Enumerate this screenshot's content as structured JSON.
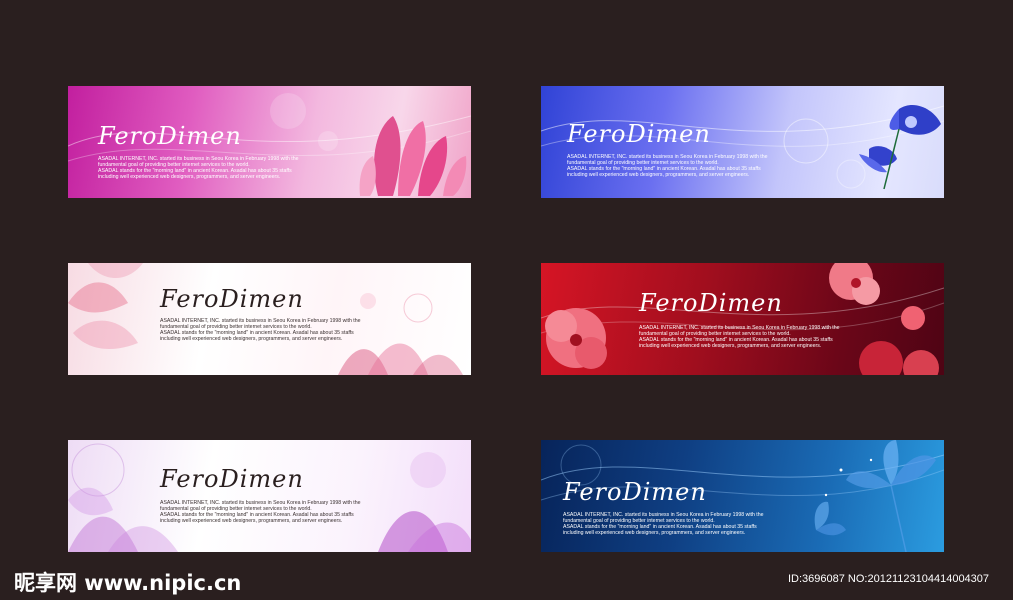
{
  "banners": [
    {
      "title": "FeroDimen",
      "description": [
        "ASADAL INTERNET, INC. started its business in Seou Korea in February 1998 with the",
        "fundamental goal of providing better internet services to the world.",
        "ASADAL stands for the \"morning land\" in ancient Korean. Asadal has about 35 staffs",
        "including well experienced web designers, programmers, and server engineers."
      ]
    },
    {
      "title": "FeroDimen",
      "description": [
        "ASADAL INTERNET, INC. started its business in Seou Korea in February 1998 with the",
        "fundamental goal of providing better internet services to the world.",
        "ASADAL stands for the \"morning land\" in ancient Korean. Asadal has about 35 staffs",
        "including well experienced web designers, programmers, and server engineers."
      ]
    },
    {
      "title": "FeroDimen",
      "description": [
        "ASADAL INTERNET, INC. started its business in Seou Korea in February 1998 with the",
        "fundamental goal of providing better internet services to the world.",
        "ASADAL stands for the \"morning land\" in ancient Korean. Asadal has about 35 staffs",
        "including well experienced web designers, programmers, and server engineers."
      ]
    },
    {
      "title": "FeroDimen",
      "description": [
        "ASADAL INTERNET, INC. started its business in Seou Korea in February 1998 with the",
        "fundamental goal of providing better internet services to the world.",
        "ASADAL stands for the \"morning land\" in ancient Korean. Asadal has about 35 staffs",
        "including well experienced web designers, programmers, and server engineers."
      ]
    },
    {
      "title": "FeroDimen",
      "description": [
        "ASADAL INTERNET, INC. started its business in Seou Korea in February 1998 with the",
        "fundamental goal of providing better internet services to the world.",
        "ASADAL stands for the \"morning land\" in ancient Korean. Asadal has about 35 staffs",
        "including well experienced web designers, programmers, and server engineers."
      ]
    },
    {
      "title": "FeroDimen",
      "description": [
        "ASADAL INTERNET, INC. started its business in Seou Korea in February 1998 with the",
        "fundamental goal of providing better internet services to the world.",
        "ASADAL stands for the \"morning land\" in ancient Korean. Asadal has about 35 staffs",
        "including well experienced web designers, programmers, and server engineers."
      ]
    }
  ],
  "watermark": "昵享网 www.nipic.cn",
  "image_id": "ID:3696087 NO:20121123104414004307",
  "colors": {
    "background": "#2a1f1f",
    "magenta": "#c21f9f",
    "blue": "#3043d6",
    "pink": "#f7dbe3",
    "red": "#a10e1e",
    "lilac": "#eedcf5",
    "navy": "#0f3f83"
  }
}
